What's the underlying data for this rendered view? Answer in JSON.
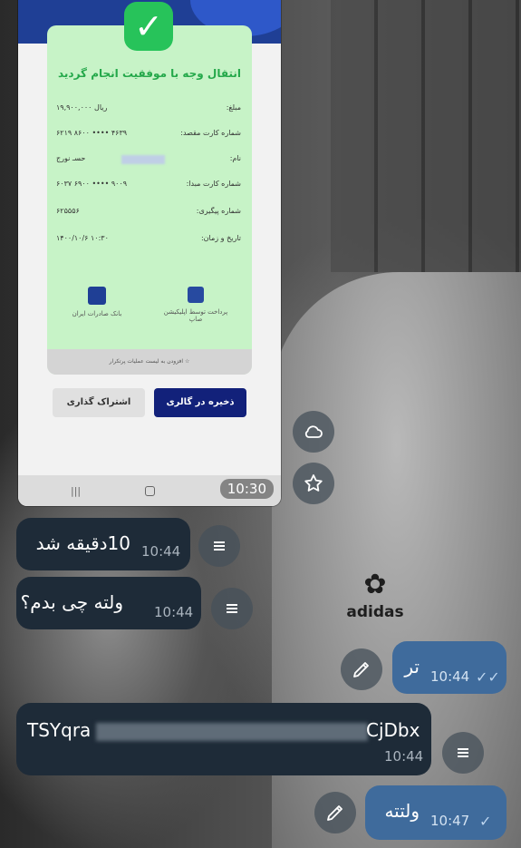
{
  "receipt": {
    "title": "انتقال وجه با موفقیت انجام گردید",
    "rows": [
      {
        "label": "مبلغ:",
        "value": "۱۹,۹۰۰,۰۰۰ ریال"
      },
      {
        "label": "شماره کارت مقصد:",
        "value": "۶۲۱۹ ۸۶۰۰ •••• ۴۶۳۹"
      },
      {
        "label": "نام:",
        "value": "حسـ نورج"
      },
      {
        "label": "شماره کارت مبدا:",
        "value": "۶۰۳۷ ۶۹۰۰ •••• ۹۰۰۹"
      },
      {
        "label": "شماره پیگیری:",
        "value": "۶۲۵۵۵۶"
      },
      {
        "label": "تاریخ و زمان:",
        "value": "۱۴۰۰/۱۰/۶ ۱۰:۳۰"
      }
    ],
    "bank_left": "بانک صادرات ایران",
    "bank_right": "پرداخت توسط اپلیکیشن صاپ",
    "footer": "افزودن به لیست عملیات پرتکرار",
    "save_button": "ذخیره در گالری",
    "share_button": "اشتراک گذاری",
    "image_time": "10:30"
  },
  "messages": [
    {
      "text": "10دقیقه شد",
      "time": "10:44",
      "direction": "in"
    },
    {
      "text": "ولته چی بدم؟",
      "time": "10:44",
      "direction": "in"
    },
    {
      "text": "تر",
      "time": "10:44",
      "direction": "out",
      "status": "read"
    },
    {
      "text_start": "TSYqra",
      "text_end": "CjDbx",
      "time": "10:44",
      "direction": "in"
    },
    {
      "text": "ولتته",
      "time": "10:47",
      "direction": "out",
      "status": "sent"
    }
  ],
  "background": {
    "logo_text": "adidas"
  },
  "icons": {
    "cloud": "cloud-icon",
    "star": "star-icon",
    "edit": "pencil-icon",
    "menu": "menu-icon"
  }
}
